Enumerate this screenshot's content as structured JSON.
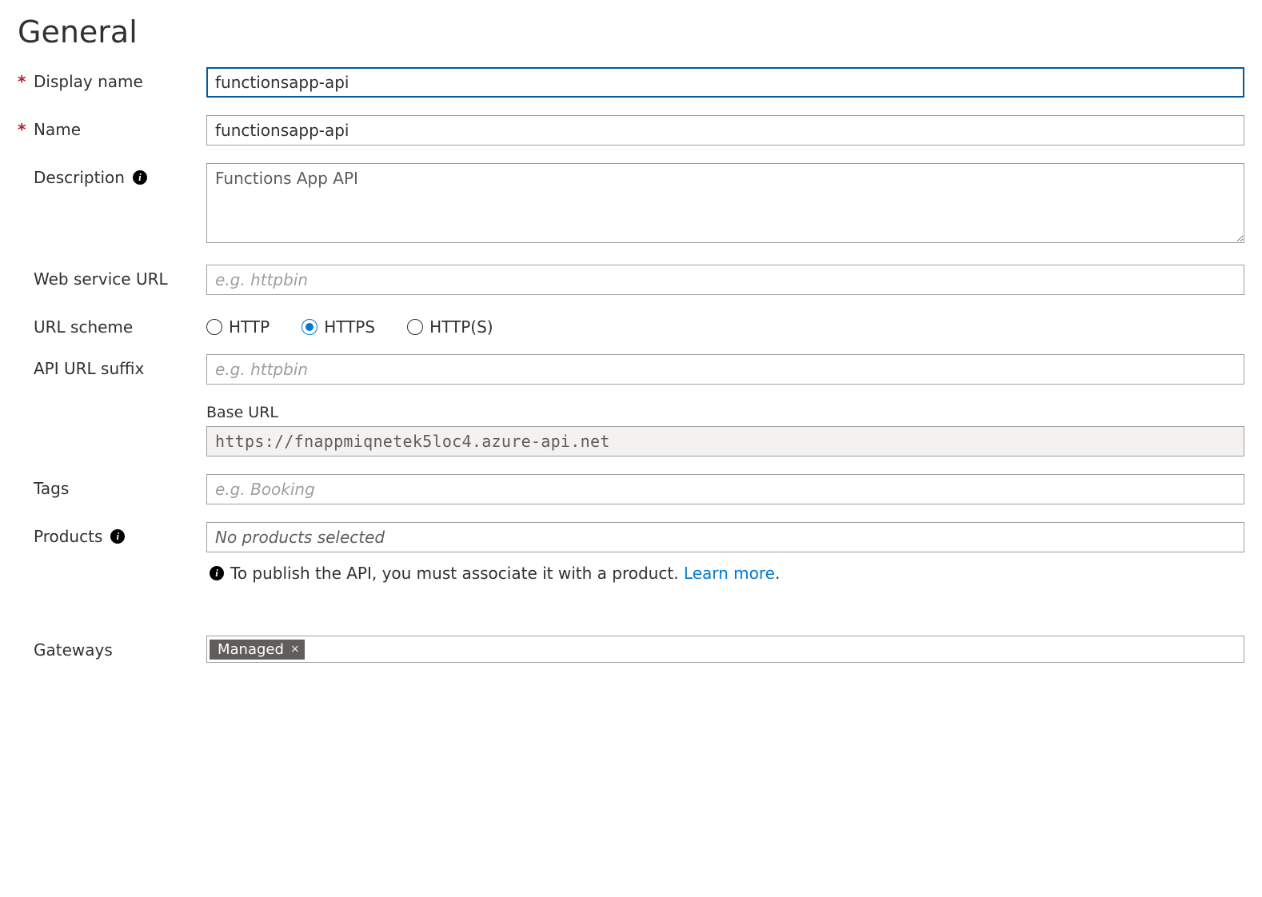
{
  "section_title": "General",
  "fields": {
    "display_name": {
      "label": "Display name",
      "value": "functionsapp-api",
      "required": true
    },
    "name": {
      "label": "Name",
      "value": "functionsapp-api",
      "required": true
    },
    "description": {
      "label": "Description",
      "value": "Functions App API"
    },
    "web_service_url": {
      "label": "Web service URL",
      "placeholder": "e.g. httpbin",
      "value": ""
    },
    "url_scheme": {
      "label": "URL scheme",
      "selected": "HTTPS",
      "options": [
        "HTTP",
        "HTTPS",
        "HTTP(S)"
      ]
    },
    "api_url_suffix": {
      "label": "API URL suffix",
      "placeholder": "e.g. httpbin",
      "value": ""
    },
    "base_url": {
      "label": "Base URL",
      "value": "https://fnappmiqnetek5loc4.azure-api.net"
    },
    "tags": {
      "label": "Tags",
      "placeholder": "e.g. Booking",
      "value": ""
    },
    "products": {
      "label": "Products",
      "placeholder": "No products selected"
    },
    "gateways": {
      "label": "Gateways",
      "chips": [
        "Managed"
      ]
    }
  },
  "helper": {
    "text": "To publish the API, you must associate it with a product. ",
    "link_text": "Learn more",
    "trailing": "."
  }
}
